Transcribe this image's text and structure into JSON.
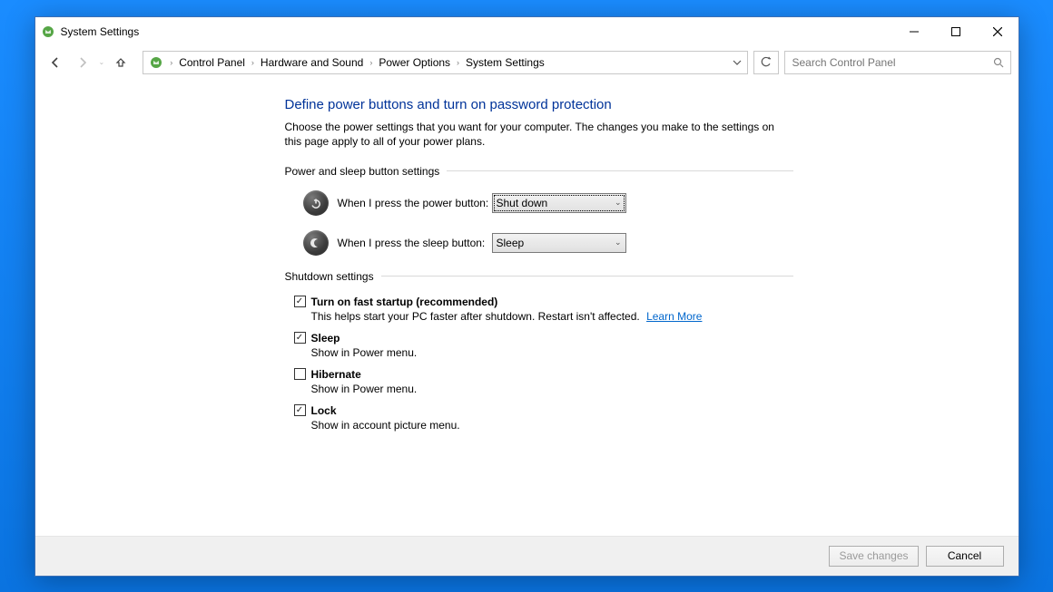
{
  "window": {
    "title": "System Settings",
    "controls": {
      "min": "minimize",
      "max": "maximize",
      "close": "close"
    }
  },
  "nav": {
    "breadcrumbs": [
      "Control Panel",
      "Hardware and Sound",
      "Power Options",
      "System Settings"
    ],
    "search_placeholder": "Search Control Panel"
  },
  "page": {
    "title": "Define power buttons and turn on password protection",
    "description": "Choose the power settings that you want for your computer. The changes you make to the settings on this page apply to all of your power plans."
  },
  "sections": {
    "power_sleep_label": "Power and sleep button settings",
    "shutdown_label": "Shutdown settings"
  },
  "settings": {
    "power_button": {
      "label": "When I press the power button:",
      "value": "Shut down"
    },
    "sleep_button": {
      "label": "When I press the sleep button:",
      "value": "Sleep"
    }
  },
  "shutdown": [
    {
      "label": "Turn on fast startup (recommended)",
      "checked": true,
      "desc": "This helps start your PC faster after shutdown. Restart isn't affected.",
      "link": "Learn More"
    },
    {
      "label": "Sleep",
      "checked": true,
      "desc": "Show in Power menu."
    },
    {
      "label": "Hibernate",
      "checked": false,
      "desc": "Show in Power menu."
    },
    {
      "label": "Lock",
      "checked": true,
      "desc": "Show in account picture menu."
    }
  ],
  "footer": {
    "save": "Save changes",
    "cancel": "Cancel"
  }
}
